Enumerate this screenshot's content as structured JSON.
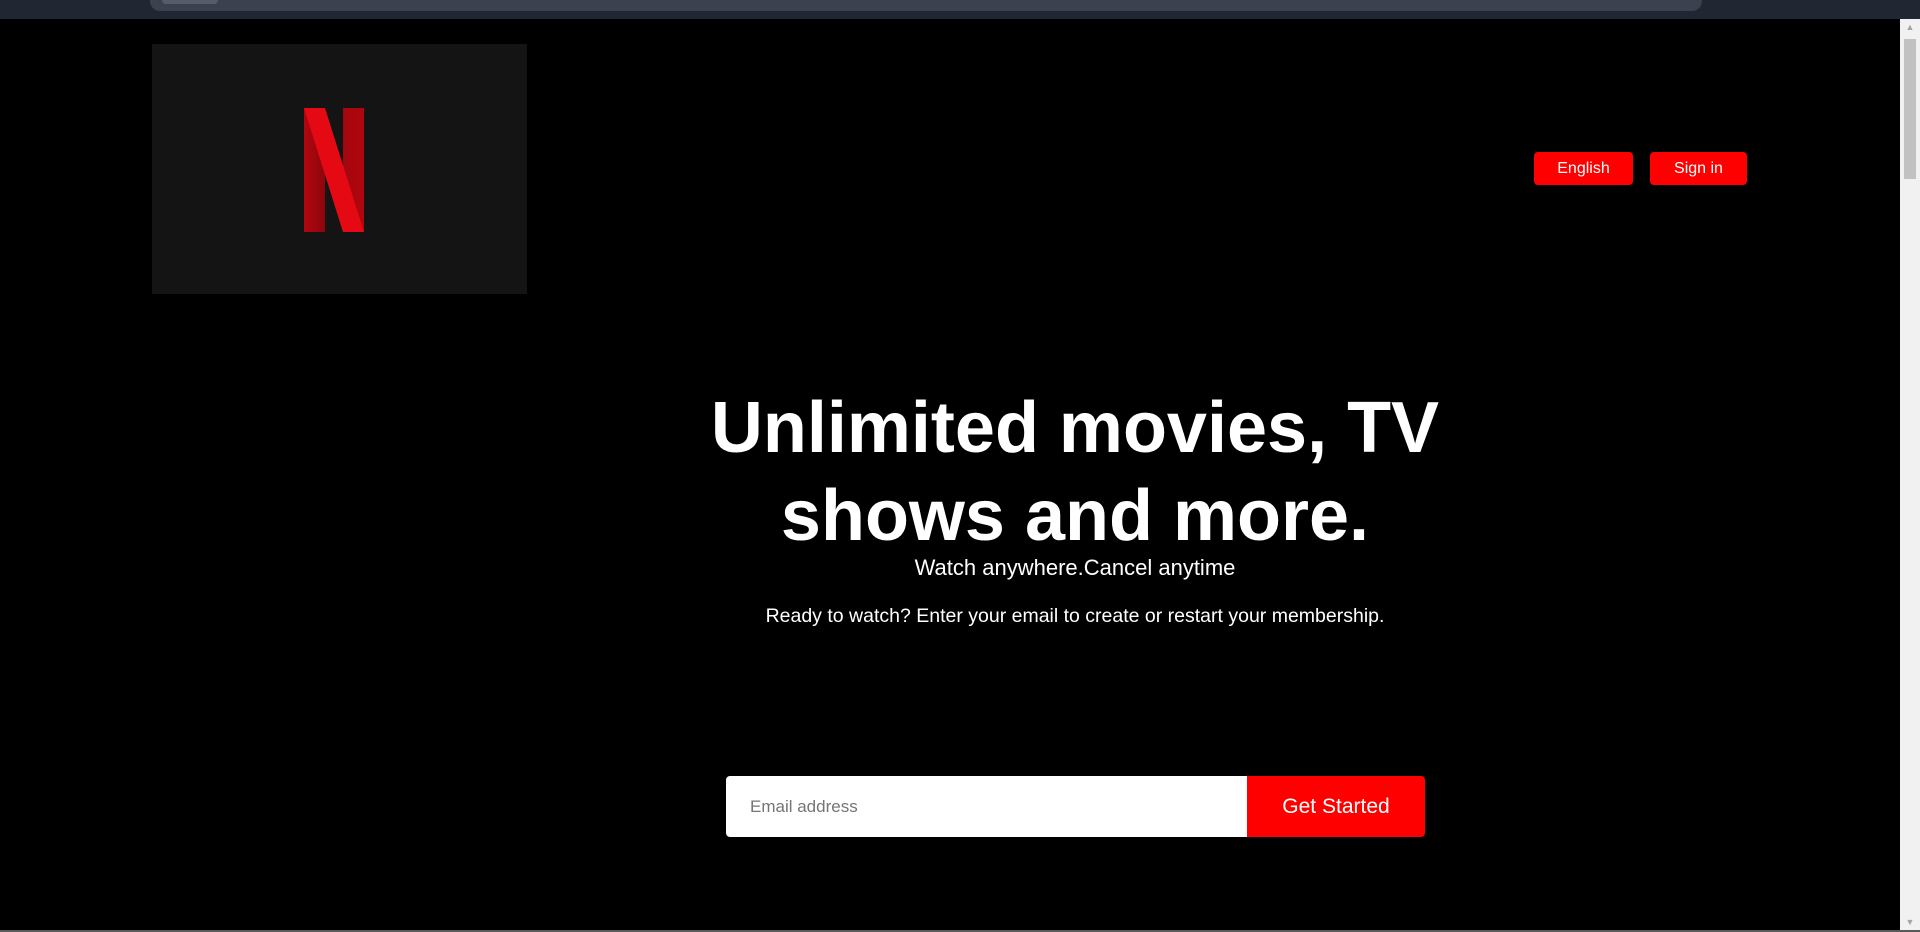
{
  "colors": {
    "background": "#000000",
    "accent": "#ff0000",
    "logo_panel": "#141414",
    "logo_red": "#e50914"
  },
  "header": {
    "logo_icon": "netflix-n-logo",
    "language_label": "English",
    "signin_label": "Sign in"
  },
  "hero": {
    "title": "Unlimited movies, TV shows and more.",
    "subtitle": "Watch anywhere.Cancel anytime",
    "prompt": "Ready to watch? Enter your email to create or restart your membership.",
    "email_placeholder": "Email address",
    "email_value": "",
    "cta_label": "Get Started"
  }
}
